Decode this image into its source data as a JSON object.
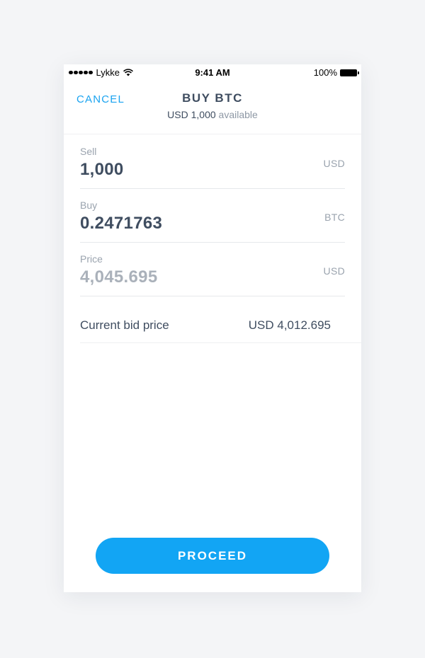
{
  "status_bar": {
    "carrier": "Lykke",
    "time": "9:41 AM",
    "battery": "100%",
    "icons": [
      "signal-dots-icon",
      "wifi-icon",
      "battery-icon"
    ]
  },
  "header": {
    "cancel_label": "CANCEL",
    "title": "BUY BTC",
    "balance_amount": "USD 1,000",
    "balance_suffix": "available"
  },
  "fields": {
    "sell": {
      "label": "Sell",
      "value": "1,000",
      "unit": "USD"
    },
    "buy": {
      "label": "Buy",
      "value": "0.2471763",
      "unit": "BTC"
    },
    "price": {
      "label": "Price",
      "value": "4,045.695",
      "unit": "USD"
    }
  },
  "bid": {
    "label": "Current bid price",
    "value": "USD 4,012.695"
  },
  "proceed_label": "PROCEED",
  "colors": {
    "accent": "#12a5f4",
    "text": "#3f4d60",
    "muted": "#9aa3ae",
    "background": "#f4f5f7"
  }
}
